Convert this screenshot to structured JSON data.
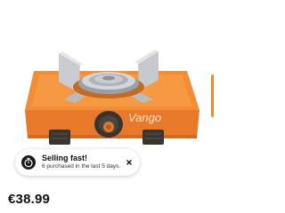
{
  "product": {
    "brand_logo": "Vango",
    "price": "€38.99",
    "accent_color": "#f0892a"
  },
  "toast": {
    "icon": "stopwatch-icon",
    "title": "Selling fast!",
    "subtitle": "6 purchased in the last 5 days.",
    "close_icon": "close-icon"
  }
}
